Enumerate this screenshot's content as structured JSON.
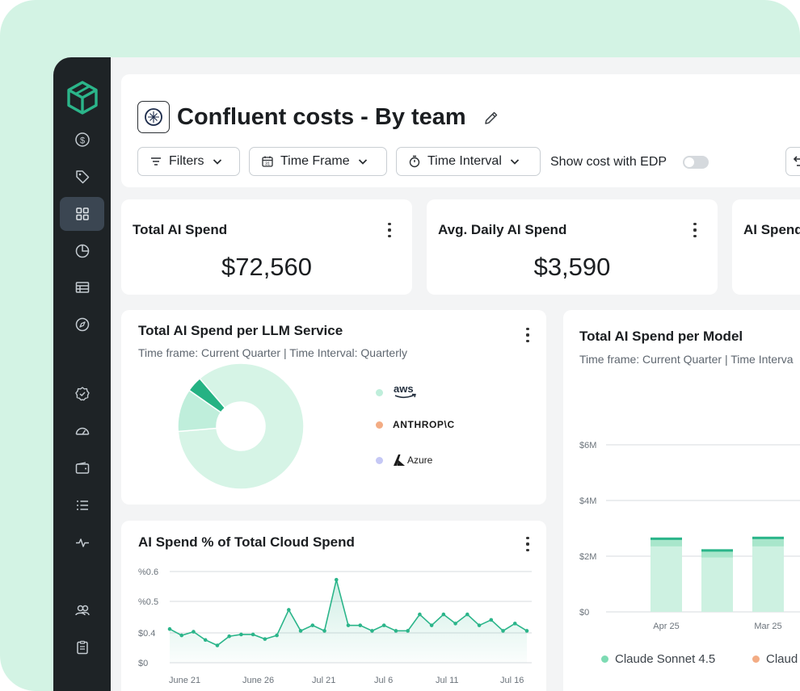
{
  "header": {
    "title": "Confluent costs - By team",
    "filters_label": "Filters",
    "timeframe_label": "Time Frame",
    "interval_label": "Time Interval",
    "edp_label": "Show cost with EDP"
  },
  "kpis": [
    {
      "title": "Total AI Spend",
      "value": "$72,560"
    },
    {
      "title": "Avg. Daily AI Spend",
      "value": "$3,590"
    },
    {
      "title": "AI Spend"
    }
  ],
  "llm_card": {
    "title": "Total AI Spend per LLM Service",
    "subtitle": "Time frame: Current Quarter | Time Interval: Quarterly",
    "legend": [
      "aws",
      "ANTHROP\\C",
      "Azure"
    ]
  },
  "pct_card": {
    "title": "AI Spend % of Total Cloud Spend"
  },
  "model_card": {
    "title": "Total AI Spend per Model",
    "subtitle": "Time frame: Current Quarter | Time Interva",
    "legend": [
      "Claude Sonnet 4.5",
      "Claud"
    ]
  },
  "colors": {
    "mint_bg": "#d3f3e4",
    "sidebar": "#1e2326",
    "accent": "#2bb58a",
    "aws": "#bfeedb",
    "anthropic": "#f3ac84",
    "azure": "#c5c8f5",
    "bar_light": "#cdf1e1",
    "bar_dark": "#2bb58a"
  },
  "icons": [
    "cube-logo",
    "dollar-icon",
    "tag-icon",
    "grid-icon",
    "pie-icon",
    "table-icon",
    "compass-icon",
    "badge-check-icon",
    "gauge-icon",
    "wallet-icon",
    "list-icon",
    "pulse-icon",
    "users-icon",
    "clipboard-icon"
  ],
  "chart_data": [
    {
      "type": "pie",
      "labels": [
        "aws",
        "ANTHROP\\C",
        "Azure"
      ],
      "values": [
        85,
        11,
        4
      ]
    },
    {
      "type": "area",
      "x": [
        "June 21",
        "June 26",
        "Jul 21",
        "Jul 6",
        "Jul 11",
        "Jul 16"
      ],
      "yticks": [
        "$0",
        "$0.4",
        "%0.5",
        "%0.6"
      ],
      "ylim": [
        0,
        0.6
      ],
      "values": [
        0.37,
        0.3,
        0.34,
        0.25,
        0.19,
        0.29,
        0.31,
        0.31,
        0.26,
        0.3,
        0.58,
        0.35,
        0.41,
        0.35,
        0.91,
        0.41,
        0.41,
        0.35,
        0.41,
        0.35,
        0.35,
        0.53,
        0.41,
        0.53,
        0.43,
        0.53,
        0.41,
        0.47,
        0.35,
        0.43,
        0.35
      ]
    },
    {
      "type": "bar",
      "categories": [
        "Apr 25",
        "",
        "Mar 25"
      ],
      "ylabels": [
        "$0",
        "$2M",
        "$4M",
        "$6M"
      ],
      "ylim": [
        0,
        6
      ],
      "series": [
        {
          "name": "Claude Sonnet 4.5",
          "values": [
            2.35,
            1.95,
            2.35
          ]
        },
        {
          "values": [
            0.32,
            0.3,
            0.35
          ]
        }
      ]
    }
  ]
}
